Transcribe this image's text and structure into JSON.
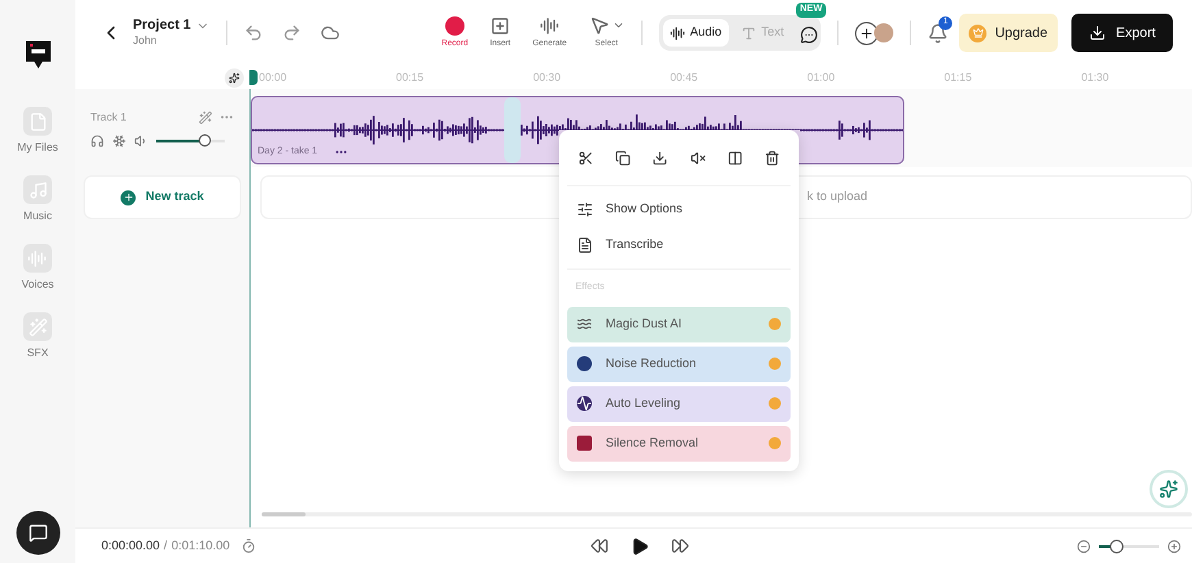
{
  "project": {
    "title": "Project 1",
    "owner": "John"
  },
  "toolbar": [
    {
      "label": "Record",
      "kind": "record"
    },
    {
      "label": "Insert",
      "kind": "insert"
    },
    {
      "label": "Generate",
      "kind": "generate"
    },
    {
      "label": "Select",
      "kind": "select"
    }
  ],
  "mode_tabs": [
    {
      "label": "Audio",
      "selected": true
    },
    {
      "label": "Text",
      "selected": false
    }
  ],
  "new_badge": "NEW",
  "notification_count": "1",
  "upgrade_button": "Upgrade",
  "export_button": "Export",
  "sidebar": [
    {
      "label": "My Files",
      "kind": "file"
    },
    {
      "label": "Music",
      "kind": "music"
    },
    {
      "label": "Voices",
      "kind": "voices"
    },
    {
      "label": "SFX",
      "kind": "sfx"
    }
  ],
  "ruler": [
    "00:00",
    "00:15",
    "00:30",
    "00:45",
    "01:00",
    "01:15",
    "01:30"
  ],
  "track": {
    "name": "Track 1",
    "level": 0.7,
    "clip_label": "Day 2 - take 1"
  },
  "new_track_button": "New track",
  "upload_hint": "k to upload",
  "context_menu": {
    "options": [
      {
        "label": "Show Options",
        "kind": "options"
      },
      {
        "label": "Transcribe",
        "kind": "transcribe"
      }
    ],
    "effects_heading": "Effects",
    "effects": [
      {
        "label": "Magic Dust AI",
        "color": "#d4ebe4"
      },
      {
        "label": "Noise Reduction",
        "color": "#d3e4f5"
      },
      {
        "label": "Auto Leveling",
        "color": "#e2ddf5"
      },
      {
        "label": "Silence Removal",
        "color": "#f7d7de"
      }
    ]
  },
  "playback": {
    "current": "0:00:00.00",
    "separator": "/",
    "total": "0:01:10.00"
  },
  "zoom": {
    "level": 0.3
  }
}
